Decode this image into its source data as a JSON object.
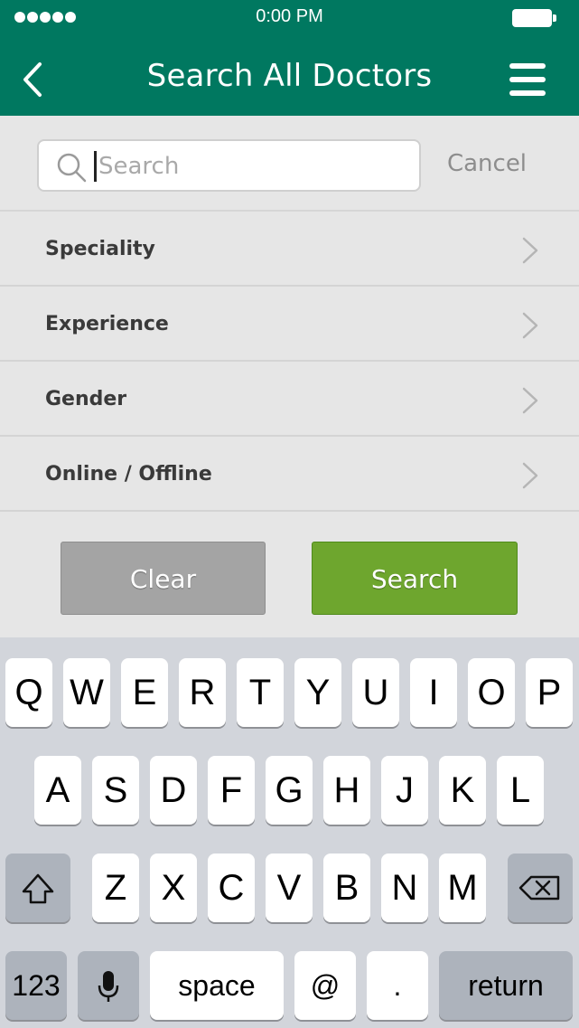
{
  "status_bar": {
    "time": "0:00 PM"
  },
  "header": {
    "title": "Search All Doctors"
  },
  "search": {
    "placeholder": "Search",
    "value": "",
    "cancel_label": "Cancel"
  },
  "filters": [
    {
      "label": "Speciality"
    },
    {
      "label": "Experience"
    },
    {
      "label": "Gender"
    },
    {
      "label": "Online / Offline"
    }
  ],
  "actions": {
    "clear_label": "Clear",
    "search_label": "Search"
  },
  "keyboard": {
    "row1": [
      "Q",
      "W",
      "E",
      "R",
      "T",
      "Y",
      "U",
      "I",
      "O",
      "P"
    ],
    "row2": [
      "A",
      "S",
      "D",
      "F",
      "G",
      "H",
      "J",
      "K",
      "L"
    ],
    "row3": [
      "Z",
      "X",
      "C",
      "V",
      "B",
      "N",
      "M"
    ],
    "numbers_label": "123",
    "space_label": "space",
    "at_label": "@",
    "dot_label": ".",
    "return_label": "return"
  },
  "colors": {
    "header": "#007860",
    "search_button": "#6ea62e",
    "clear_button": "#a4a4a4"
  }
}
